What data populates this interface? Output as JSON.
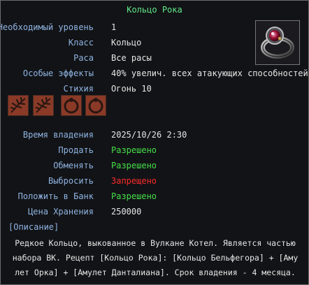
{
  "item": {
    "name": "Кольцо Рока",
    "rows": [
      {
        "label": "Необходимый уровень",
        "value": "1"
      },
      {
        "label": "Класс",
        "value": "Кольцо"
      },
      {
        "label": "Раса",
        "value": "Все расы"
      },
      {
        "label": "Особые эффекты",
        "value": "40% увелич. всех атакующих способностей"
      },
      {
        "label": "Стихия",
        "value": "Огонь 10"
      }
    ],
    "materials": [
      "leaf-material-icon",
      "leaf-material-icon",
      "ring-material-icon",
      "ring-material-icon"
    ],
    "ownership": [
      {
        "label": "Время владения",
        "value": "2025/10/26 2:30",
        "status": "neutral"
      },
      {
        "label": "Продать",
        "value": "Разрешено",
        "status": "allowed"
      },
      {
        "label": "Обменять",
        "value": "Разрешено",
        "status": "allowed"
      },
      {
        "label": "Выбросить",
        "value": "Запрещено",
        "status": "forbidden"
      },
      {
        "label": "Положить в Банк",
        "value": "Разрешено",
        "status": "allowed"
      },
      {
        "label": "Цена Хранения",
        "value": "250000",
        "status": "neutral"
      }
    ],
    "description_header": "[Описание]",
    "description": "Редкое Кольцо, выкованное в Вулкане Котел. Является частью\nнабора ВК. Рецепт [Кольцо Рока]: [Кольцо Бельфегора] + [Аму\nлет Орка] + [Амулет Данталиана]. Срок владения - 4 месяца."
  },
  "colors": {
    "title": "#62e88a",
    "label": "#8fb4e2",
    "allowed": "#45e04a",
    "forbidden": "#ff2a2a"
  }
}
